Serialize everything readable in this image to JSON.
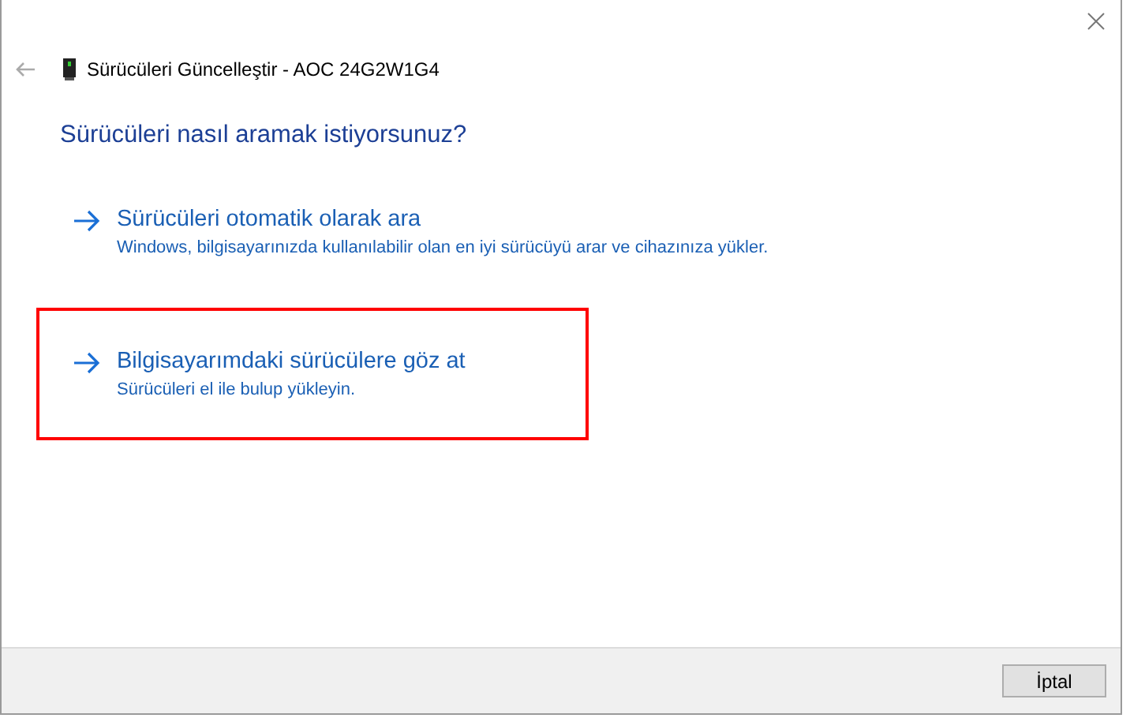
{
  "window": {
    "title": "Sürücüleri Güncelleştir - AOC 24G2W1G4"
  },
  "heading": "Sürücüleri nasıl aramak istiyorsunuz?",
  "options": [
    {
      "title": "Sürücüleri otomatik olarak ara",
      "description": "Windows, bilgisayarınızda kullanılabilir olan en iyi sürücüyü arar ve cihazınıza yükler.",
      "highlighted": false
    },
    {
      "title": "Bilgisayarımdaki sürücülere göz at",
      "description": "Sürücüleri el ile bulup yükleyin.",
      "highlighted": true
    }
  ],
  "buttons": [
    "İptal"
  ]
}
